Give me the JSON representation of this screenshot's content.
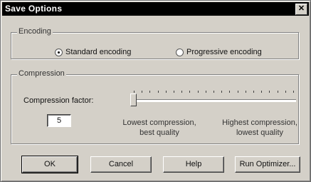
{
  "window": {
    "title": "Save Options",
    "close_glyph": "✕"
  },
  "encoding": {
    "label": "Encoding",
    "options": [
      {
        "label": "Standard encoding",
        "checked": true
      },
      {
        "label": "Progressive encoding",
        "checked": false
      }
    ]
  },
  "compression": {
    "label": "Compression",
    "factor_label": "Compression factor:",
    "factor_value": "5",
    "slider_value": 5,
    "low_caption_1": "Lowest compression,",
    "low_caption_2": "best quality",
    "high_caption_1": "Highest compression,",
    "high_caption_2": "lowest quality"
  },
  "buttons": {
    "ok": "OK",
    "cancel": "Cancel",
    "help": "Help",
    "optimizer": "Run Optimizer..."
  }
}
